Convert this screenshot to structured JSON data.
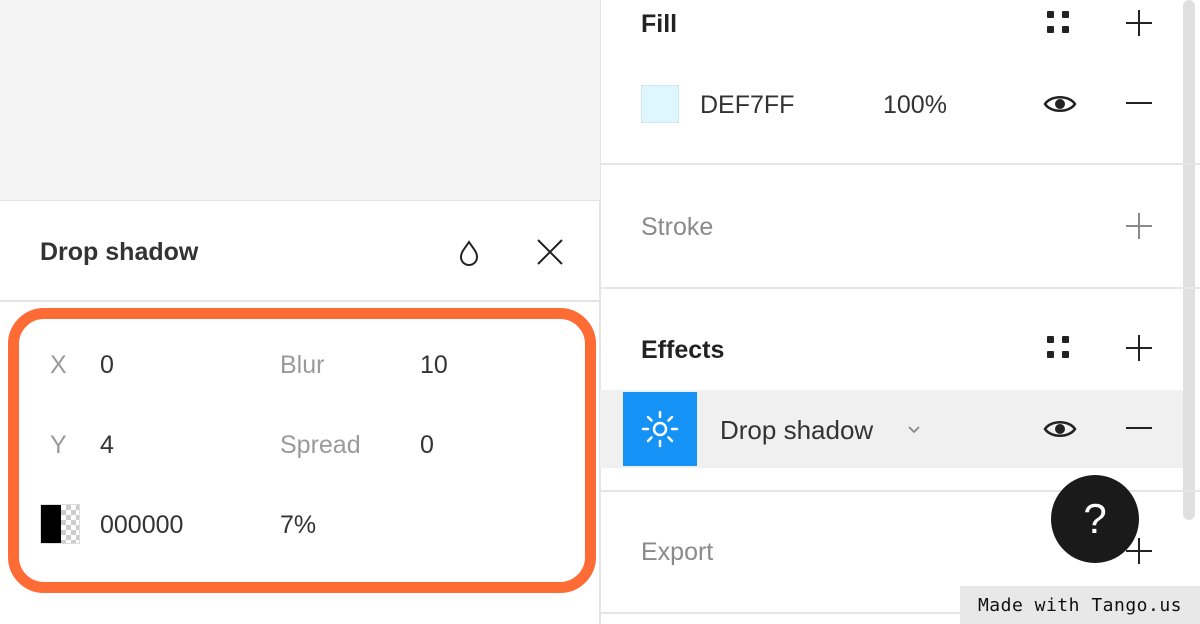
{
  "panel": {
    "fill": {
      "title": "Fill",
      "swatch_color": "#DEF7FF",
      "hex": "DEF7FF",
      "opacity": "100%"
    },
    "stroke": {
      "title": "Stroke"
    },
    "effects": {
      "title": "Effects",
      "item": {
        "name": "Drop shadow",
        "icon": "sun-icon",
        "icon_bg": "#1592F6"
      }
    },
    "export": {
      "title": "Export"
    }
  },
  "popup": {
    "title": "Drop shadow",
    "fields": {
      "x_label": "X",
      "x_value": "0",
      "y_label": "Y",
      "y_value": "4",
      "blur_label": "Blur",
      "blur_value": "10",
      "spread_label": "Spread",
      "spread_value": "0",
      "color_hex": "000000",
      "color_opacity": "7%"
    },
    "highlight_color": "#FF6B35"
  },
  "help_button": {
    "label": "?"
  },
  "watermark": {
    "text": "Made with Tango.us"
  }
}
